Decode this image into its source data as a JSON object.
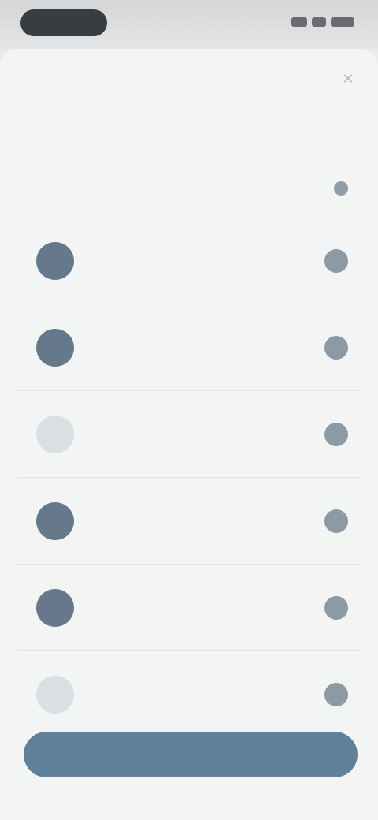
{
  "status_bar": {},
  "sheet": {
    "title": "",
    "subtitle": "",
    "section_label": "",
    "section_action": "",
    "close_icon": "close-icon"
  },
  "list": {
    "items": [
      {
        "label": "",
        "title": "",
        "subtitle": "",
        "avatar_style": "dark"
      },
      {
        "label": "",
        "title": "",
        "subtitle": "",
        "avatar_style": "dark"
      },
      {
        "label": "",
        "title": "",
        "subtitle": "",
        "avatar_style": "light"
      },
      {
        "label": "",
        "title": "",
        "subtitle": "",
        "avatar_style": "dark"
      },
      {
        "label": "",
        "title": "",
        "subtitle": "",
        "avatar_style": "dark"
      },
      {
        "label": "",
        "title": "",
        "subtitle": "",
        "avatar_style": "light"
      }
    ]
  },
  "primary_button": {
    "label": ""
  },
  "colors": {
    "accent": "#5f819a",
    "avatar_dark": "#66798a",
    "avatar_light": "#d9dfe3",
    "toggle": "#8c9aa3",
    "background": "#f3f4f4"
  }
}
